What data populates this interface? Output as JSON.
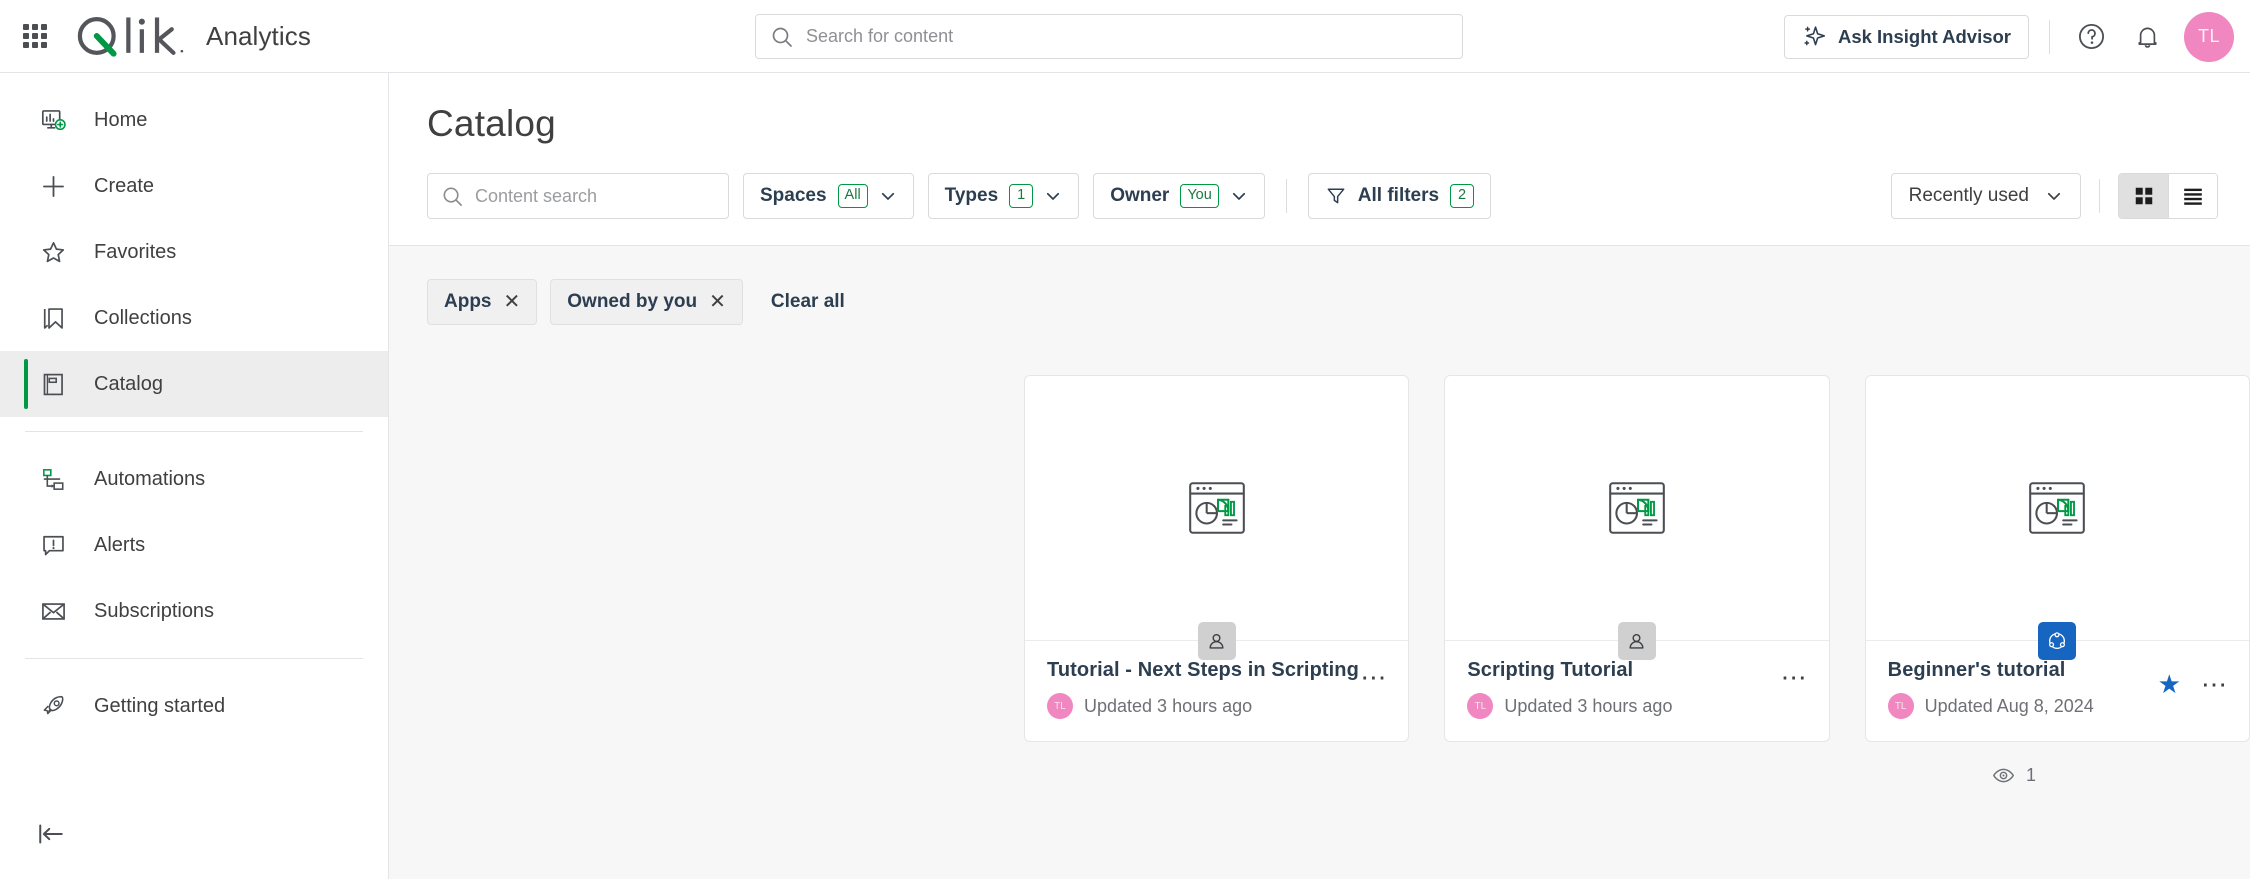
{
  "topbar": {
    "app_switcher_icon": "waffle-grid-icon",
    "logo_text": "Qlik",
    "product_name": "Analytics",
    "search": {
      "placeholder": "Search for content",
      "value": "",
      "icon": "search-icon"
    },
    "insight_advisor_button": {
      "label": "Ask Insight Advisor",
      "icon": "sparkle-icon"
    },
    "help_icon": "help-circle-icon",
    "notifications_icon": "bell-icon",
    "avatar": {
      "initials": "TL",
      "color": "#f087c0"
    }
  },
  "sidebar": {
    "items": [
      {
        "label": "Home",
        "icon": "home-dashboard-icon",
        "active": false
      },
      {
        "label": "Create",
        "icon": "plus-icon",
        "active": false
      },
      {
        "label": "Favorites",
        "icon": "star-outline-icon",
        "active": false
      },
      {
        "label": "Collections",
        "icon": "bookmark-icon",
        "active": false
      },
      {
        "label": "Catalog",
        "icon": "catalog-book-icon",
        "active": true
      },
      {
        "label": "Automations",
        "icon": "automations-flow-icon",
        "active": false
      },
      {
        "label": "Alerts",
        "icon": "alert-speech-bubble-icon",
        "active": false
      },
      {
        "label": "Subscriptions",
        "icon": "envelope-icon",
        "active": false
      },
      {
        "label": "Getting started",
        "icon": "rocket-icon",
        "active": false
      }
    ],
    "collapse_icon": "collapse-left-icon"
  },
  "main": {
    "page_title": "Catalog",
    "content_search": {
      "placeholder": "Content search",
      "value": "",
      "icon": "search-icon"
    },
    "filters": [
      {
        "label": "Spaces",
        "badge": "All",
        "icon": "chevron-down-icon"
      },
      {
        "label": "Types",
        "badge": "1",
        "icon": "chevron-down-icon"
      },
      {
        "label": "Owner",
        "badge": "You",
        "icon": "chevron-down-icon"
      }
    ],
    "all_filters": {
      "label": "All filters",
      "badge": "2",
      "icon": "funnel-icon"
    },
    "sort": {
      "label": "Recently used",
      "icon": "chevron-down-icon"
    },
    "view_toggle": {
      "grid": {
        "icon": "grid-view-icon",
        "selected": true
      },
      "list": {
        "icon": "list-view-icon",
        "selected": false
      }
    },
    "chips": [
      {
        "label": "Apps",
        "remove_icon": "close-x-icon"
      },
      {
        "label": "Owned by you",
        "remove_icon": "close-x-icon"
      }
    ],
    "clear_all": "Clear all",
    "cards": [
      {
        "name": "Tutorial - Next Steps in Scripting",
        "updated": "Updated 3 hours ago",
        "owner_initials": "TL",
        "thumb_icon": "app-chart-thumbnail-icon",
        "badge_icon": "person-icon",
        "badge_type": "personal",
        "favorite": false,
        "kebab_icon": "more-options-icon"
      },
      {
        "name": "Scripting Tutorial",
        "updated": "Updated 3 hours ago",
        "owner_initials": "TL",
        "thumb_icon": "app-chart-thumbnail-icon",
        "badge_icon": "person-icon",
        "badge_type": "personal",
        "favorite": false,
        "kebab_icon": "more-options-icon"
      },
      {
        "name": "Beginner's tutorial",
        "updated": "Updated Aug 8, 2024",
        "owner_initials": "TL",
        "thumb_icon": "app-chart-thumbnail-icon",
        "badge_icon": "shared-space-icon",
        "badge_type": "shared",
        "favorite": true,
        "favorite_icon": "star-filled-icon",
        "kebab_icon": "more-options-icon"
      }
    ],
    "view_count": {
      "icon": "eye-icon",
      "value": "1"
    }
  },
  "colors": {
    "brand_green": "#009845",
    "accent_blue": "#1665c0",
    "avatar_pink": "#f087c0",
    "text_dark": "#404040",
    "bg_gray": "#f7f7f8"
  }
}
